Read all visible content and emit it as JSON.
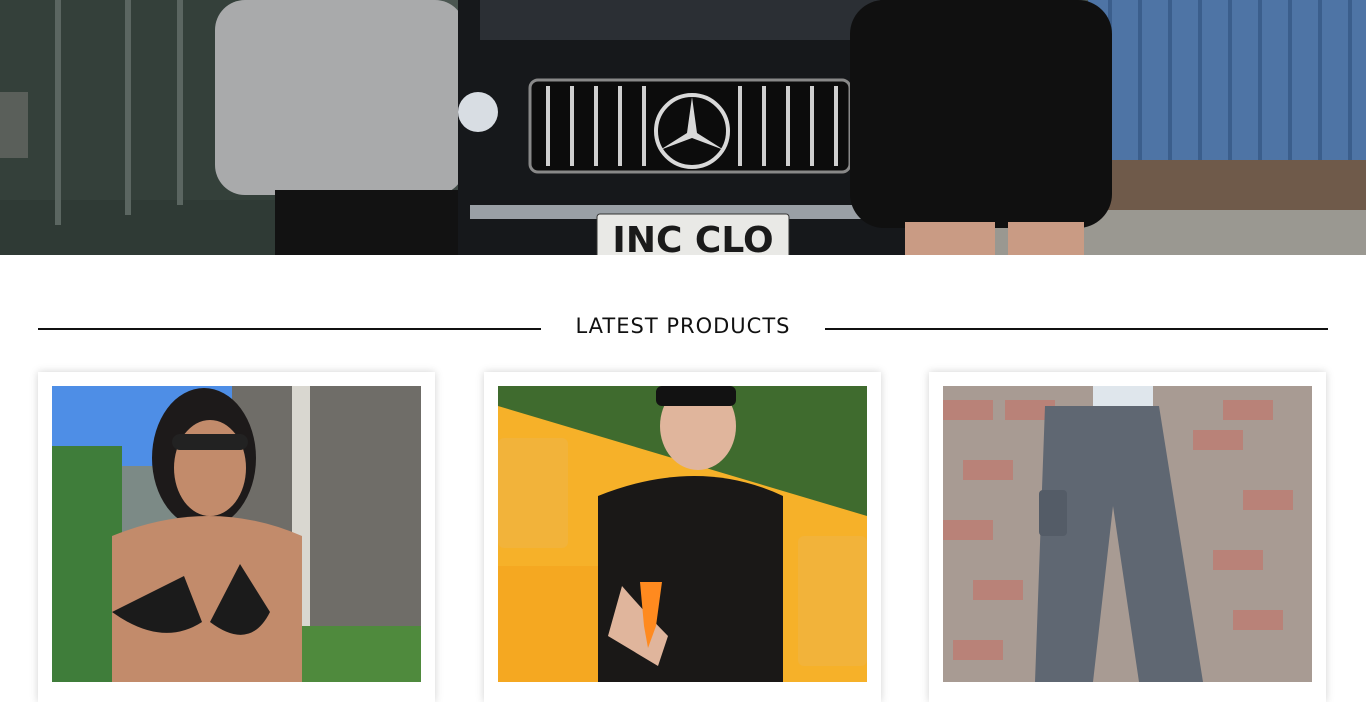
{
  "hero": {
    "plate_text": "INC CLO"
  },
  "latest": {
    "title": "LATEST PRODUCTS"
  },
  "products": [
    {
      "photo_icon": "product-photo-bikini"
    },
    {
      "photo_icon": "product-photo-tshirt"
    },
    {
      "photo_icon": "product-photo-cargo-pants"
    }
  ],
  "colors": {
    "rule": "#111111",
    "heading": "#111111"
  }
}
